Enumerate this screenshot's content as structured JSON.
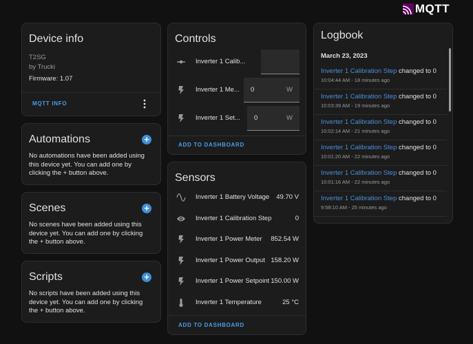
{
  "brand": {
    "logo_text": "MQTT"
  },
  "device_info": {
    "title": "Device info",
    "model": "T2SG",
    "manufacturer": "by Trucki",
    "firmware": "Firmware: 1.07",
    "mqtt_info_label": "MQTT INFO",
    "menu_icon": "dots-vertical-icon"
  },
  "automations": {
    "title": "Automations",
    "description": "No automations have been added using this device yet. You can add one by clicking the + button above."
  },
  "scenes": {
    "title": "Scenes",
    "description": "No scenes have been added using this device yet. You can add one by clicking the + button above."
  },
  "scripts": {
    "title": "Scripts",
    "description": "No scripts have been added using this device yet. You can add one by clicking the + button above."
  },
  "controls": {
    "title": "Controls",
    "items": [
      {
        "label": "Inverter 1 Calib...",
        "value": "",
        "unit": "",
        "icon": "slider-icon"
      },
      {
        "label": "Inverter 1 Me...",
        "value": "0",
        "unit": "W",
        "icon": "flash-icon"
      },
      {
        "label": "Inverter 1 Set...",
        "value": "0",
        "unit": "W",
        "icon": "flash-icon"
      }
    ],
    "add_label": "ADD TO DASHBOARD"
  },
  "sensors": {
    "title": "Sensors",
    "items": [
      {
        "label": "Inverter 1 Battery Voltage",
        "value": "49.70 V",
        "icon": "sine-wave-icon"
      },
      {
        "label": "Inverter 1 Calibration Step",
        "value": "0",
        "icon": "eye-icon"
      },
      {
        "label": "Inverter 1 Power Meter",
        "value": "852.54 W",
        "icon": "flash-icon"
      },
      {
        "label": "Inverter 1 Power Output",
        "value": "158.20 W",
        "icon": "flash-icon"
      },
      {
        "label": "Inverter 1 Power Setpoint",
        "value": "150.00 W",
        "icon": "flash-icon"
      },
      {
        "label": "Inverter 1 Temperature",
        "value": "25 °C",
        "icon": "thermometer-icon"
      }
    ],
    "add_label": "ADD TO DASHBOARD"
  },
  "logbook": {
    "title": "Logbook",
    "date": "March 23, 2023",
    "entries": [
      {
        "entity": "Inverter 1 Calibration Step",
        "message": "changed to 0",
        "time": "10:04:44 AM - 18 minutes ago"
      },
      {
        "entity": "Inverter 1 Calibration Step",
        "message": "changed to 0",
        "time": "10:03:39 AM - 19 minutes ago"
      },
      {
        "entity": "Inverter 1 Calibration Step",
        "message": "changed to 0",
        "time": "10:02:14 AM - 21 minutes ago"
      },
      {
        "entity": "Inverter 1 Calibration Step",
        "message": "changed to 0",
        "time": "10:01:20 AM - 22 minutes ago"
      },
      {
        "entity": "Inverter 1 Calibration Step",
        "message": "changed to 0",
        "time": "10:01:16 AM - 22 minutes ago"
      },
      {
        "entity": "Inverter 1 Calibration Step",
        "message": "changed to 0",
        "time": "9:58:10 AM - 25 minutes ago"
      }
    ]
  },
  "colors": {
    "accent": "#4a9ee8",
    "background": "#111111",
    "card": "#1c1c1c"
  }
}
